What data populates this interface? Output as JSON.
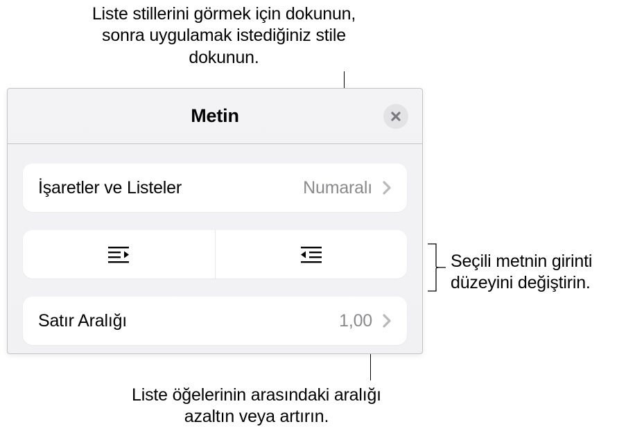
{
  "callouts": {
    "top": "Liste stillerini görmek için dokunun, sonra uygulamak istediğiniz stile dokunun.",
    "right": "Seçili metnin girinti düzeyini değiştirin.",
    "bottom": "Liste öğelerinin arasındaki aralığı azaltın veya artırın."
  },
  "panel": {
    "title": "Metin",
    "rows": {
      "bullets_label": "İşaretler ve Listeler",
      "bullets_value": "Numaralı",
      "line_spacing_label": "Satır Aralığı",
      "line_spacing_value": "1,00"
    }
  }
}
